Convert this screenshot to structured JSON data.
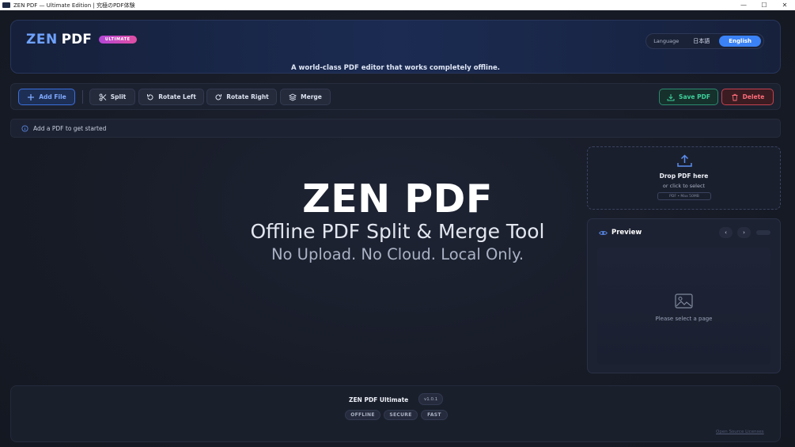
{
  "window": {
    "title": "ZEN PDF — Ultimate Edition | 究極のPDF体験",
    "minimize": "—",
    "maximize": "☐",
    "close": "✕"
  },
  "header": {
    "logo_primary": "ZEN",
    "logo_secondary": "PDF",
    "edition_badge": "ULTIMATE",
    "tagline": "A world-class PDF editor that works completely offline.",
    "language": {
      "label": "Language",
      "options": [
        "日本語",
        "English"
      ],
      "selected": "English"
    }
  },
  "toolbar": {
    "add_file": "Add File",
    "split": "Split",
    "rotate_left": "Rotate Left",
    "rotate_right": "Rotate Right",
    "merge": "Merge",
    "save_pdf": "Save PDF",
    "delete": "Delete"
  },
  "status": {
    "message": "Add a PDF to get started"
  },
  "hero": {
    "title": "ZEN PDF",
    "subtitle": "Offline PDF Split & Merge Tool",
    "subtitle2": "No Upload. No Cloud. Local Only."
  },
  "dropzone": {
    "title": "Drop PDF here",
    "subtitle": "or click to select",
    "hint": "PDF • Max 50MB"
  },
  "preview": {
    "title": "Preview",
    "prev": "‹",
    "next": "›",
    "empty_message": "Please select a page"
  },
  "footer": {
    "product_name": "ZEN PDF Ultimate",
    "version": "v1.0.1",
    "chips": [
      "OFFLINE",
      "SECURE",
      "FAST"
    ],
    "license_link": "Open Source Licenses"
  },
  "colors": {
    "accent": "#3b82f6",
    "save": "#3ecf9a",
    "delete": "#ff6b78",
    "badge": "#c84bc0"
  }
}
